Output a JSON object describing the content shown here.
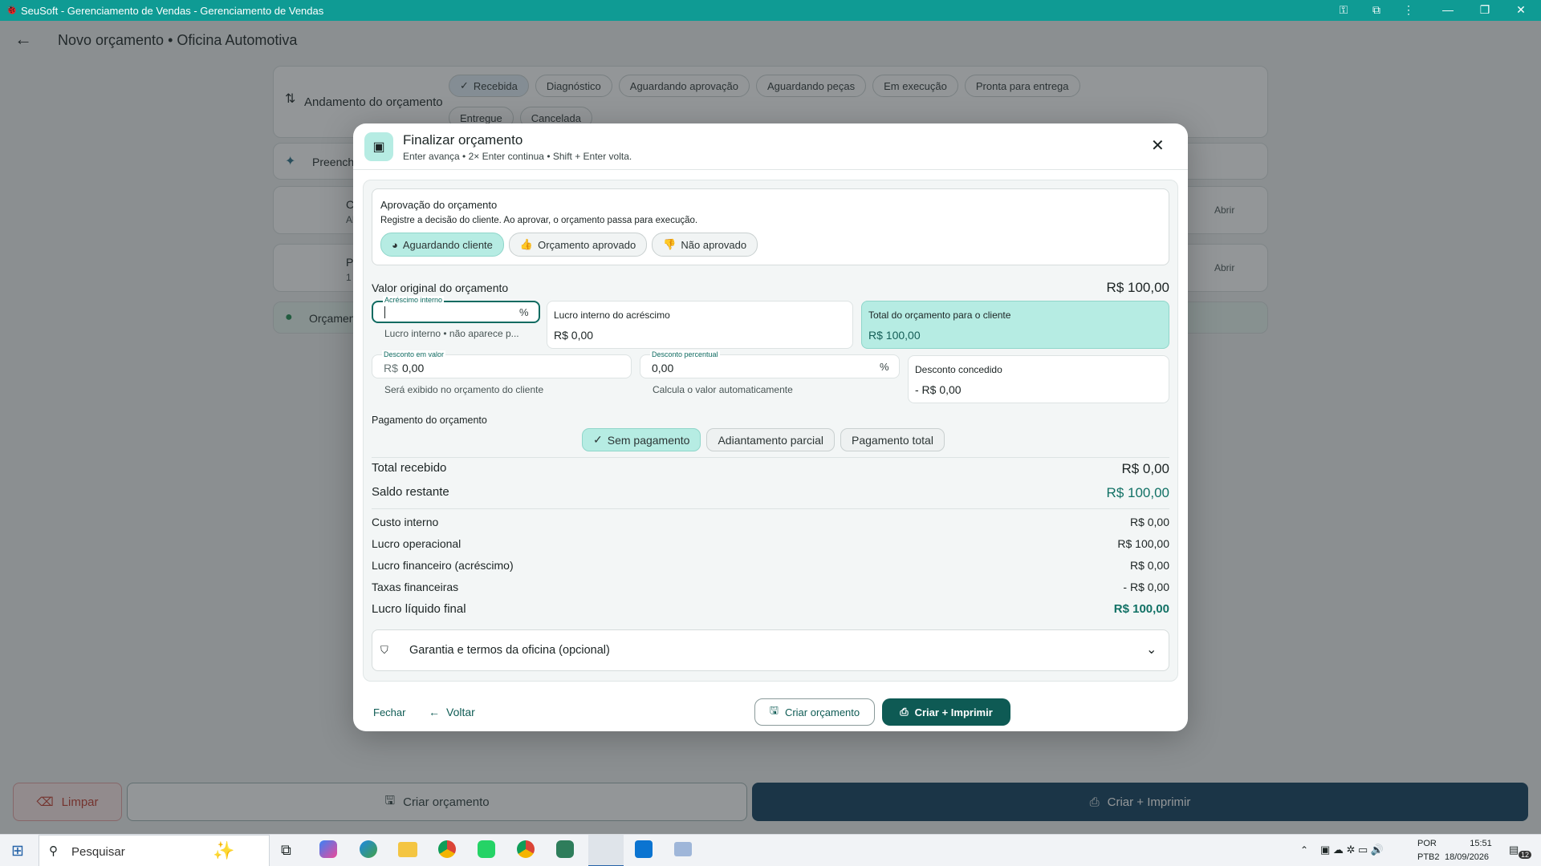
{
  "window": {
    "title": "SeuSoft - Gerenciamento de Vendas - Gerenciamento de Vendas"
  },
  "appbar": {
    "title": "Novo orçamento • Oficina Automotiva"
  },
  "progress": {
    "label": "Andamento do orçamento",
    "stages": [
      "Recebida",
      "Diagnóstico",
      "Aguardando aprovação",
      "Aguardando peças",
      "Em execução",
      "Pronta para entrega",
      "Entregue",
      "Cancelada"
    ],
    "selected": "Recebida"
  },
  "background": {
    "fill_label": "Preench",
    "card1": {
      "title": "C",
      "sub": "Al",
      "action": "Abrir"
    },
    "card2": {
      "title": "P",
      "sub": "1",
      "action": "Abrir"
    },
    "status_label": "Orçamen"
  },
  "bottom": {
    "clear": "Limpar",
    "create": "Criar orçamento",
    "create_print": "Criar + Imprimir"
  },
  "modal": {
    "title": "Finalizar orçamento",
    "subtitle": "Enter avança • 2× Enter continua • Shift + Enter volta.",
    "approval": {
      "title": "Aprovação do orçamento",
      "desc": "Registre a decisão do cliente. Ao aprovar, o orçamento passa para execução.",
      "options": [
        "Aguardando cliente",
        "Orçamento aprovado",
        "Não aprovado"
      ],
      "selected": "Aguardando cliente"
    },
    "original": {
      "label": "Valor original do orçamento",
      "value": "R$ 100,00"
    },
    "markup": {
      "label": "Acréscimo interno",
      "value": "",
      "suffix": "%",
      "helper": "Lucro interno • não aparece p..."
    },
    "markup_profit": {
      "label": "Lucro interno do acréscimo",
      "value": "R$ 0,00"
    },
    "client_total": {
      "label": "Total do orçamento para o cliente",
      "value": "R$ 100,00"
    },
    "discount_value": {
      "label": "Desconto em valor",
      "prefix": "R$",
      "value": "0,00",
      "helper": "Será exibido no orçamento do cliente"
    },
    "discount_percent": {
      "label": "Desconto percentual",
      "value": "0,00",
      "suffix": "%",
      "helper": "Calcula o valor automaticamente"
    },
    "discount_given": {
      "label": "Desconto concedido",
      "value": "- R$ 0,00"
    },
    "payment": {
      "label": "Pagamento do orçamento",
      "options": [
        "Sem pagamento",
        "Adiantamento parcial",
        "Pagamento total"
      ],
      "selected": "Sem pagamento"
    },
    "summary": [
      {
        "label": "Total recebido",
        "value": "R$ 0,00"
      },
      {
        "label": "Saldo restante",
        "value": "R$ 100,00"
      },
      {
        "label": "Custo interno",
        "value": "R$ 0,00"
      },
      {
        "label": "Lucro operacional",
        "value": "R$ 100,00"
      },
      {
        "label": "Lucro financeiro (acréscimo)",
        "value": "R$ 0,00"
      },
      {
        "label": "Taxas financeiras",
        "value": "- R$ 0,00"
      },
      {
        "label": "Lucro líquido final",
        "value": "R$ 100,00"
      }
    ],
    "warranty": "Garantia e termos da oficina (opcional)",
    "footer": {
      "close": "Fechar",
      "back": "Voltar",
      "create": "Criar orçamento",
      "create_print": "Criar + Imprimir"
    }
  },
  "taskbar": {
    "search": "Pesquisar",
    "lang": "POR",
    "layout": "PTB2",
    "time": "15:51",
    "date": "18/09/2026",
    "notif": "12"
  },
  "colors": {
    "teal": "#0f9b94",
    "accent": "#117165",
    "dark_button": "#0e5a54",
    "chip_selected": "#b6ece3"
  }
}
